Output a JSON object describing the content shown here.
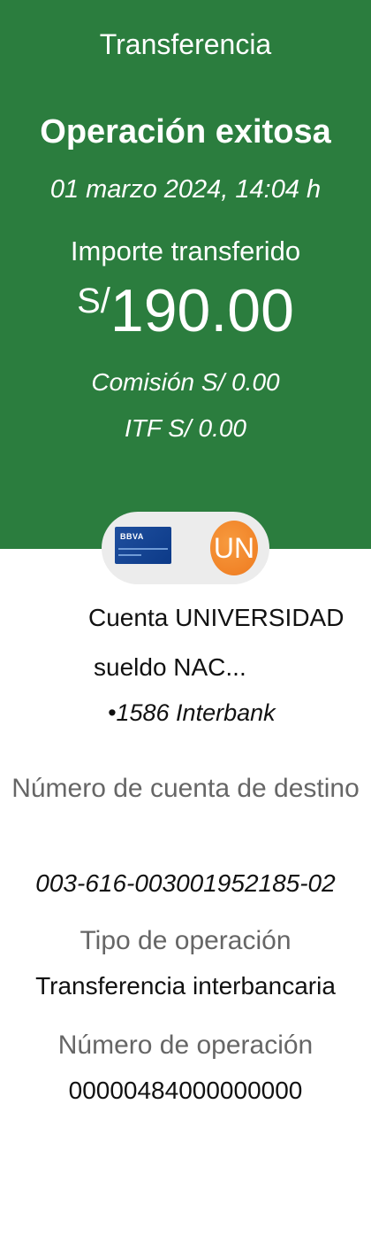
{
  "header": {
    "screen_title": "Transferencia",
    "status_title": "Operación exitosa",
    "date_time": "01 marzo 2024, 14:04 h",
    "amount_label": "Importe transferido",
    "currency_symbol": "S/",
    "amount": "190.00",
    "fee": "Comisión S/ 0.00",
    "itf": "ITF S/ 0.00",
    "background_color": "#2b7d3e"
  },
  "logos": {
    "card_brand": "BBVA",
    "destination_badge": "UN",
    "badge_color": "#ee7a1f"
  },
  "account": {
    "name_line1": "Cuenta UNIVERSIDAD",
    "name_line2": "sueldo NAC...",
    "masked_number": "•1586",
    "bank": "Interbank"
  },
  "details": {
    "destination_label": "Número de cuenta de destino",
    "destination_value": "003-616-003001952185-02",
    "operation_type_label": "Tipo de operación",
    "operation_type_value": "Transferencia interbancaria",
    "operation_number_label": "Número de operación",
    "operation_number_value": "00000484000000000"
  }
}
